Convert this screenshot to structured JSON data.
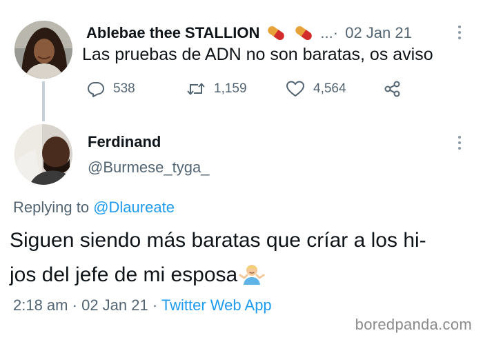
{
  "tweet1": {
    "author_name": "Ablebae thee STALLION",
    "name_icons": [
      "pill-icon",
      "pill-icon"
    ],
    "ellipsis": "...",
    "separator": "·",
    "date": "02 Jan 21",
    "text": "Las pruebas de ADN no son baratas, os aviso",
    "reply_count": "538",
    "retweet_count": "1,159",
    "like_count": "4,564",
    "icons": {
      "reply": "reply-icon",
      "retweet": "retweet-icon",
      "like": "heart-icon",
      "share": "share-icon",
      "more": "more-options-icon"
    }
  },
  "tweet2": {
    "author_name": "Ferdinand",
    "handle": "@Burmese_tyga_",
    "replying_prefix": "Replying to",
    "replying_handle": "@Dlaureate",
    "text_line1": "Siguen siendo más baratas que críar a los hi-",
    "text_line2": "jos del jefe de mi esposa",
    "emoji": "person-shrugging-emoji",
    "time": "2:18 am",
    "separator": "·",
    "date": "02 Jan 21",
    "source": "Twitter Web App"
  },
  "watermark": "boredpanda.com",
  "colors": {
    "text_primary": "#0f1419",
    "text_secondary": "#536471",
    "link": "#1d9bf0",
    "thread_line": "#c4cfd6",
    "watermark": "#8a8a8a"
  }
}
